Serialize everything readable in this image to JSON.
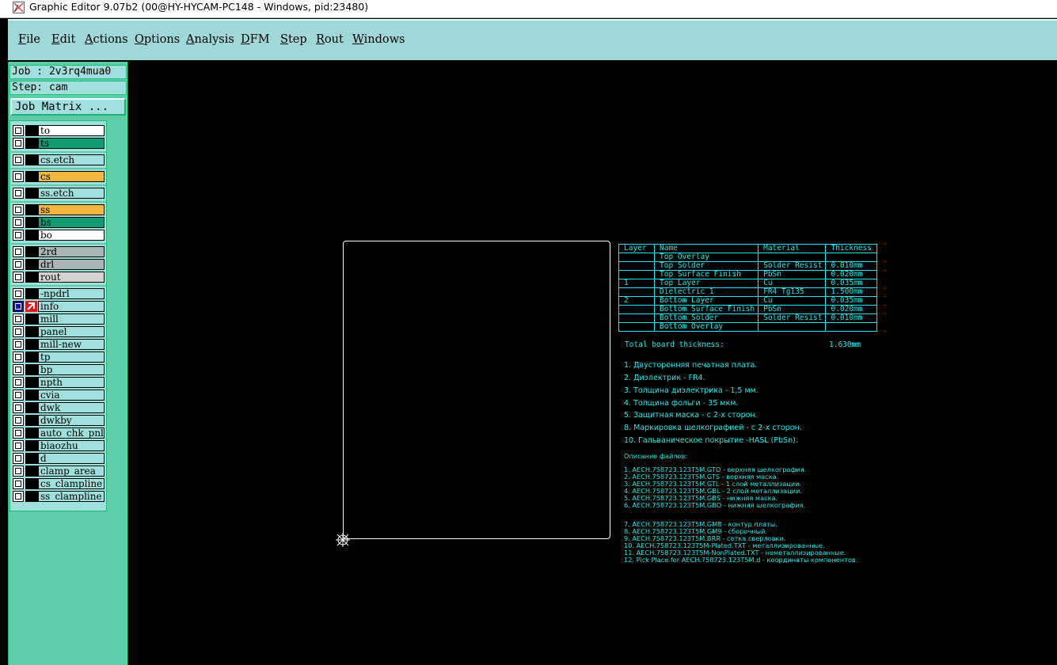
{
  "window": {
    "title": "Graphic Editor 9.07b2 (00@HY-HYCAM-PC148 - Windows, pid:23480)"
  },
  "menu": [
    "File",
    "Edit",
    "Actions",
    "Options",
    "Analysis",
    "DFM",
    "Step",
    "Rout",
    "Windows"
  ],
  "job": {
    "job_label": "Job : 2v3rq4mua0",
    "step_label": "Step: cam",
    "matrix_button": "Job Matrix ..."
  },
  "layers": [
    {
      "name": "to",
      "color": "#ffffff"
    },
    {
      "name": "ts",
      "color": "#129a72"
    },
    {
      "name": "cs.etch",
      "color": "#9fe0dc"
    },
    {
      "name": "cs",
      "color": "#f4b63e"
    },
    {
      "name": "ss.etch",
      "color": "#9fe0dc"
    },
    {
      "name": "ss",
      "color": "#f4b63e"
    },
    {
      "name": "bs",
      "color": "#129a72"
    },
    {
      "name": "bo",
      "color": "#ffffff"
    },
    {
      "name": "2rd",
      "color": "#a9b4b8"
    },
    {
      "name": "drl",
      "color": "#a9b4b8"
    },
    {
      "name": "rout",
      "color": "#d4d4d4"
    },
    {
      "name": "-npdrl",
      "color": "#9fe0dc"
    },
    {
      "name": "info",
      "color": "#9fe0dc"
    },
    {
      "name": "mill",
      "color": "#9fe0dc"
    },
    {
      "name": "panel",
      "color": "#9fe0dc"
    },
    {
      "name": "mill-new",
      "color": "#9fe0dc"
    },
    {
      "name": "tp",
      "color": "#9fe0dc"
    },
    {
      "name": "bp",
      "color": "#9fe0dc"
    },
    {
      "name": "npth",
      "color": "#9fe0dc"
    },
    {
      "name": "cvia",
      "color": "#9fe0dc"
    },
    {
      "name": "dwk",
      "color": "#9fe0dc"
    },
    {
      "name": "dwkby",
      "color": "#9fe0dc"
    },
    {
      "name": "auto_chk_pnl",
      "color": "#9fe0dc"
    },
    {
      "name": "biaozhu",
      "color": "#9fe0dc"
    },
    {
      "name": "d",
      "color": "#9fe0dc"
    },
    {
      "name": "clamp_area",
      "color": "#9fe0dc"
    },
    {
      "name": "cs_clampline",
      "color": "#9fe0dc"
    },
    {
      "name": "ss_clampline",
      "color": "#9fe0dc"
    }
  ],
  "stackup": {
    "headers": [
      "Layer",
      "Name",
      "Material",
      "Thickness"
    ],
    "rows": [
      [
        "",
        "Top Overlay",
        "",
        ""
      ],
      [
        "",
        "Top Solder",
        "Solder Resist",
        "0.010mm"
      ],
      [
        "",
        "Top Surface Finish",
        "PbSn",
        "0.020mm"
      ],
      [
        "1",
        "Top Layer",
        "Cu",
        "0.035mm"
      ],
      [
        "",
        "Dielectric 1",
        "FR4 Tg135",
        "1.500mm"
      ],
      [
        "2",
        "Bottom Layer",
        "Cu",
        "0.035mm"
      ],
      [
        "",
        "Bottom Surface Finish",
        "PbSn",
        "0.020mm"
      ],
      [
        "",
        "Bottom Solder",
        "Solder Resist",
        "0.010mm"
      ],
      [
        "",
        "Bottom Overlay",
        "",
        ""
      ]
    ],
    "total_label": "Total board thickness:",
    "total_value": "1.630mm"
  },
  "notes": [
    "1. Двусторонняя печатная плата.",
    "2. Диэлектрик - FR4.",
    "3. Толщина диэлектрика - 1,5 мм.",
    "4. Толщина фольги - 35 мкм.",
    "5. Защитная маска - с 2-х сторон.",
    "8. Маркировка шелкографией - с 2-х сторон.",
    "10. Гальваническое покрытие -HASL (PbSn)."
  ],
  "files_title": "Описание файлов:",
  "files_a": [
    "1. AECH.758723.123T5M.GTO - верхняя шелкография.",
    "2. AECH.758723.123T5M.GTS - верхняя маска.",
    "3. AECH.758723.123T5M.GTL - 1 слой металлизации.",
    "4. AECH.758723.123T5M.GBL - 2 слой металлизации.",
    "5. AECH.758723.123T5M.GBS - нижняя маска.",
    "6. AECH.758723.123T5M.GBO - нижняя шелкография."
  ],
  "files_b": [
    "7. AECH.758723.123T5M.GM8 - контур платы.",
    "8. AECH.758723.123T5M.GM9 - сборочный.",
    "9. AECH.758723.123T5M.BRR - сетка сверловки.",
    "10. AECH.758723.123T5M-Plated.TXT - металлизированные.",
    "11. AECH.758723.123T5M-NonPlated.TXT - неметаллизированные.",
    "12. Pick Place for AECH.758723.123T5M.d - координаты компонентов."
  ]
}
